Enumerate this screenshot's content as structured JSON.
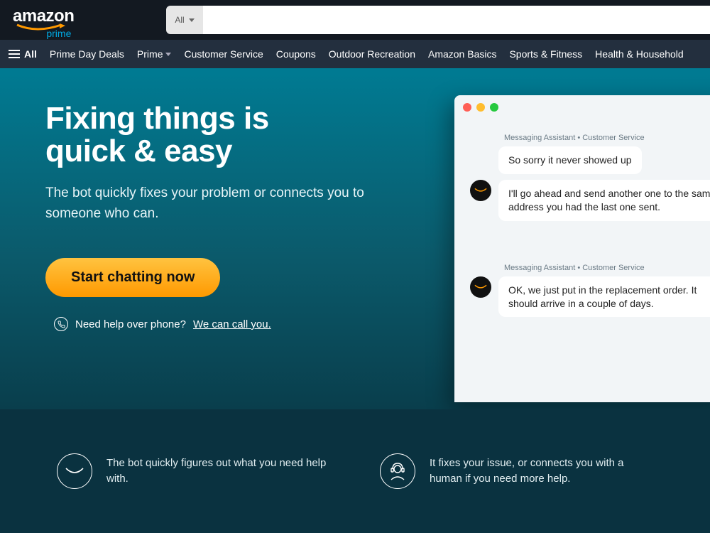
{
  "header": {
    "logo_text": "amazon",
    "logo_sub": "prime",
    "search_category": "All"
  },
  "nav": {
    "all_label": "All",
    "items": [
      "Prime Day Deals",
      "Prime",
      "Customer Service",
      "Coupons",
      "Outdoor Recreation",
      "Amazon Basics",
      "Sports & Fitness",
      "Health & Household"
    ]
  },
  "hero": {
    "title_line1": "Fixing things is",
    "title_line2": "quick & easy",
    "subtitle": "The bot quickly fixes your problem or connects you to someone who can.",
    "cta_label": "Start chatting now",
    "phone_prompt": "Need help over phone?",
    "phone_link": "We can call you."
  },
  "chat": {
    "label": "Messaging Assistant • Customer Service",
    "groups": [
      {
        "messages": [
          "So sorry it never showed up",
          "I'll go ahead and send another one to the same address you had the last one sent."
        ]
      },
      {
        "messages": [
          "OK, we just put in the replacement order. It should arrive in a couple of days."
        ]
      }
    ]
  },
  "features": [
    {
      "text": "The bot quickly figures out what you need help with."
    },
    {
      "text": "It fixes your issue, or connects you with a human if you need more help."
    }
  ]
}
